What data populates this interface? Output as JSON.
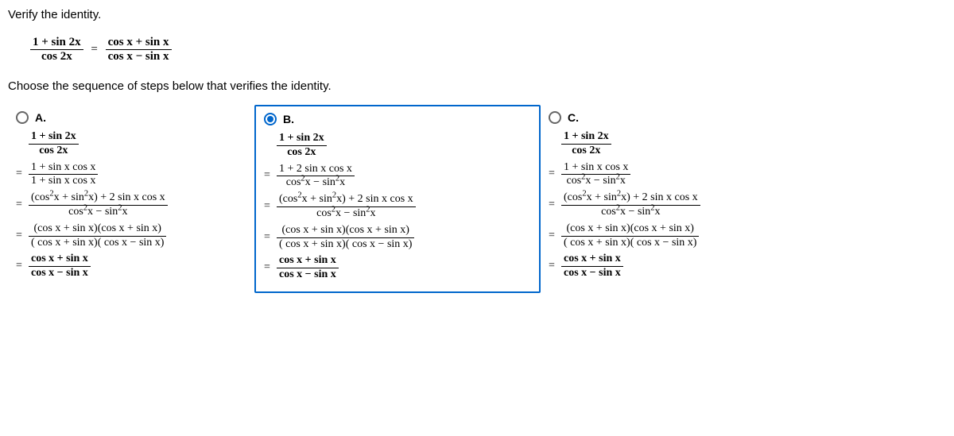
{
  "instruction": "Verify the identity.",
  "identity": {
    "lhs_num": "1 + sin 2x",
    "lhs_den": "cos 2x",
    "rhs_num": "cos x + sin x",
    "rhs_den": "cos x − sin x"
  },
  "question": "Choose the sequence of steps below that verifies the identity.",
  "options": {
    "a": {
      "label": "A.",
      "start_num": "1 + sin 2x",
      "start_den": "cos 2x",
      "step1_num": "1 + sin x cos x",
      "step1_den": "1 + sin x cos x",
      "step2_num_a": "cos",
      "step2_num_b": "x + sin",
      "step2_num_c": "x",
      "step2_num_d": " + 2 sin x cos x",
      "step2_den_a": "cos",
      "step2_den_b": "x − sin",
      "step2_den_c": "x",
      "step3_num": "(cos x + sin x)(cos x + sin x)",
      "step3_den": "( cos x + sin x)( cos x − sin x)",
      "step4_num": "cos x + sin x",
      "step4_den": "cos x − sin x"
    },
    "b": {
      "label": "B.",
      "start_num": "1 + sin 2x",
      "start_den": "cos 2x",
      "step1_num": "1 + 2 sin x cos x",
      "step1_den_a": "cos",
      "step1_den_b": "x − sin",
      "step1_den_c": "x",
      "step2_num_a": "cos",
      "step2_num_b": "x + sin",
      "step2_num_c": "x",
      "step2_num_d": " + 2 sin x cos x",
      "step2_den_a": "cos",
      "step2_den_b": "x − sin",
      "step2_den_c": "x",
      "step3_num": "(cos x + sin x)(cos x + sin x)",
      "step3_den": "( cos x + sin x)( cos x − sin x)",
      "step4_num": "cos x + sin x",
      "step4_den": "cos x − sin x"
    },
    "c": {
      "label": "C.",
      "start_num": "1 + sin 2x",
      "start_den": "cos 2x",
      "step1_num": "1 + sin x cos x",
      "step1_den_a": "cos",
      "step1_den_b": "x − sin",
      "step1_den_c": "x",
      "step2_num_a": "cos",
      "step2_num_b": "x + sin",
      "step2_num_c": "x",
      "step2_num_d": " + 2 sin x cos x",
      "step2_den_a": "cos",
      "step2_den_b": "x − sin",
      "step2_den_c": "x",
      "step3_num": "(cos x + sin x)(cos x + sin x)",
      "step3_den": "( cos x + sin x)( cos x − sin x)",
      "step4_num": "cos x + sin x",
      "step4_den": "cos x − sin x"
    }
  },
  "sup2": "2"
}
